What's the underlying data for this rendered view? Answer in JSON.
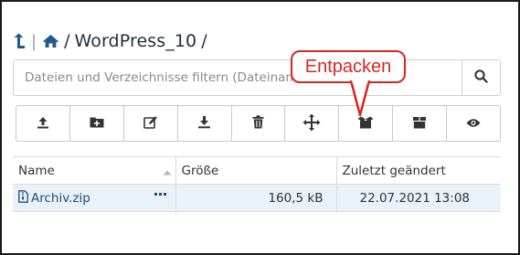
{
  "breadcrumb": {
    "up_icon": "level-up-icon",
    "home_icon": "home-icon",
    "separator": "/",
    "folder": "WordPress_10",
    "trailing_separator": "/"
  },
  "search": {
    "placeholder": "Dateien und Verzeichnisse filtern (Dateiname",
    "icon": "search-icon"
  },
  "toolbar": {
    "buttons": [
      {
        "name": "upload-button",
        "icon": "upload-icon"
      },
      {
        "name": "new-folder-button",
        "icon": "folder-plus-icon"
      },
      {
        "name": "edit-button",
        "icon": "edit-icon"
      },
      {
        "name": "download-button",
        "icon": "download-icon"
      },
      {
        "name": "delete-button",
        "icon": "trash-icon"
      },
      {
        "name": "move-button",
        "icon": "move-icon"
      },
      {
        "name": "extract-button",
        "icon": "open-box-icon"
      },
      {
        "name": "compress-button",
        "icon": "archive-box-icon"
      },
      {
        "name": "view-button",
        "icon": "eye-icon"
      }
    ]
  },
  "table": {
    "headers": {
      "name": "Name",
      "size": "Größe",
      "modified": "Zuletzt geändert"
    },
    "rows": [
      {
        "name": "Archiv.zip",
        "size": "160,5 kB",
        "modified": "22.07.2021 13:08"
      }
    ]
  },
  "callout": {
    "text": "Entpacken",
    "color": "#d7261e"
  },
  "colors": {
    "accent": "#1f4e79",
    "row_selected": "#e9f1f9"
  }
}
